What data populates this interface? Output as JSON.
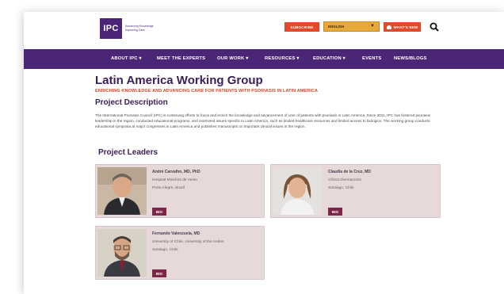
{
  "header": {
    "logo_text": "IPC",
    "logo_tagline": "Advancing Knowledge Improving Care",
    "subscribe_label": "SUBSCRIBE",
    "language_selected": "ENGLISH",
    "whats_new_label": "WHAT'S NEW"
  },
  "nav": {
    "items": [
      {
        "label": "ABOUT IPC ▾"
      },
      {
        "label": "MEET THE EXPERTS"
      },
      {
        "label": "OUR WORK ▾"
      },
      {
        "label": "RESOURCES ▾"
      },
      {
        "label": "EDUCATION ▾"
      },
      {
        "label": "EVENTS"
      },
      {
        "label": "NEWS/BLOGS"
      }
    ]
  },
  "main": {
    "title": "Latin America Working Group",
    "subtitle": "ENRICHING KNOWLEDGE AND ADVANCING CARE FOR PATIENTS WITH PSORIASIS IN LATIN AMERICA",
    "section_heading": "Project Description",
    "description": "The International Psoriasis Council (IPC) is continuing efforts to focus and enrich the knowledge and advancement of care of patients with psoriasis in Latin America. Since 2011, IPC has fostered psoriasis leadership in the region, conducted educational programs, and examined issues specific to Latin America, such as limited healthcare resources and limited access to biologics. The working group conducts educational symposia at major congresses in Latin America and publishes manuscripts on important clinical issues in the region.",
    "leaders_heading": "Project Leaders"
  },
  "leaders": [
    {
      "name": "André Carvalho, MD, PhD",
      "line1": "Hospital Moinhos de Vento",
      "line2": "Porto Alegre, Brazil",
      "bio_label": "BIO"
    },
    {
      "name": "Claudia de la Cruz, MD",
      "line1": "Clínica Dermacross",
      "line2": "Santiago, Chile",
      "bio_label": "BIO"
    },
    {
      "name": "Fernando Valenzuela, MD",
      "line1": "University of Chile, University of the Andes",
      "line2": "Santiago, Chile",
      "bio_label": "BIO"
    }
  ],
  "colors": {
    "brand_purple": "#4b2676",
    "accent_orange": "#e04a2a",
    "language_gold": "#e7a93a",
    "card_bg": "#e7d9d9",
    "bio_button": "#7d2648"
  }
}
